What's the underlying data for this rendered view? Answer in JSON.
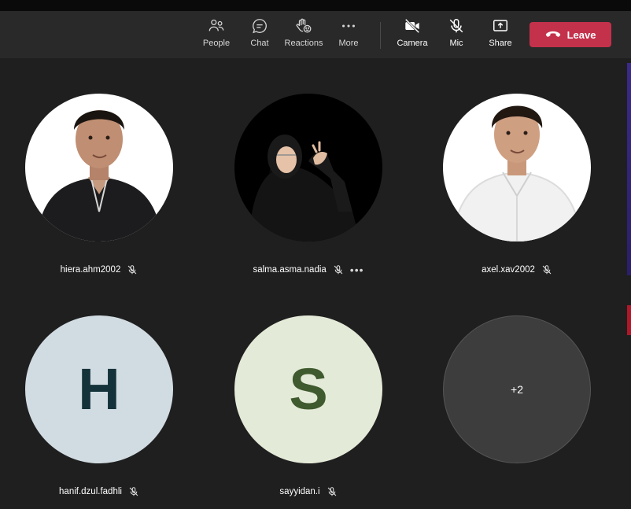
{
  "toolbar": {
    "buttons": [
      {
        "id": "people",
        "label": "People",
        "icon": "people-icon"
      },
      {
        "id": "chat",
        "label": "Chat",
        "icon": "chat-icon"
      },
      {
        "id": "reactions",
        "label": "Reactions",
        "icon": "raise-hand-icon"
      },
      {
        "id": "more",
        "label": "More",
        "icon": "more-icon"
      },
      {
        "id": "camera",
        "label": "Camera",
        "icon": "camera-off-icon"
      },
      {
        "id": "mic",
        "label": "Mic",
        "icon": "mic-off-icon"
      },
      {
        "id": "share",
        "label": "Share",
        "icon": "share-icon"
      }
    ],
    "leave_label": "Leave",
    "leave_color": "#c4314b"
  },
  "participants": [
    {
      "name": "hiera.ahm2002",
      "type": "photo",
      "muted": true
    },
    {
      "name": "salma.asma.nadia",
      "type": "photo",
      "muted": true,
      "has_menu": true
    },
    {
      "name": "axel.xav2002",
      "type": "photo",
      "muted": true
    },
    {
      "name": "hanif.dzul.fadhli",
      "type": "initial",
      "initial": "H",
      "bg": "#d1dce2",
      "fg": "#14323a",
      "muted": true
    },
    {
      "name": "sayyidan.i",
      "type": "initial",
      "initial": "S",
      "bg": "#e4ead8",
      "fg": "#3f5a2e",
      "muted": true
    }
  ],
  "overflow": {
    "label": "+2",
    "bg": "#3d3d3d"
  }
}
